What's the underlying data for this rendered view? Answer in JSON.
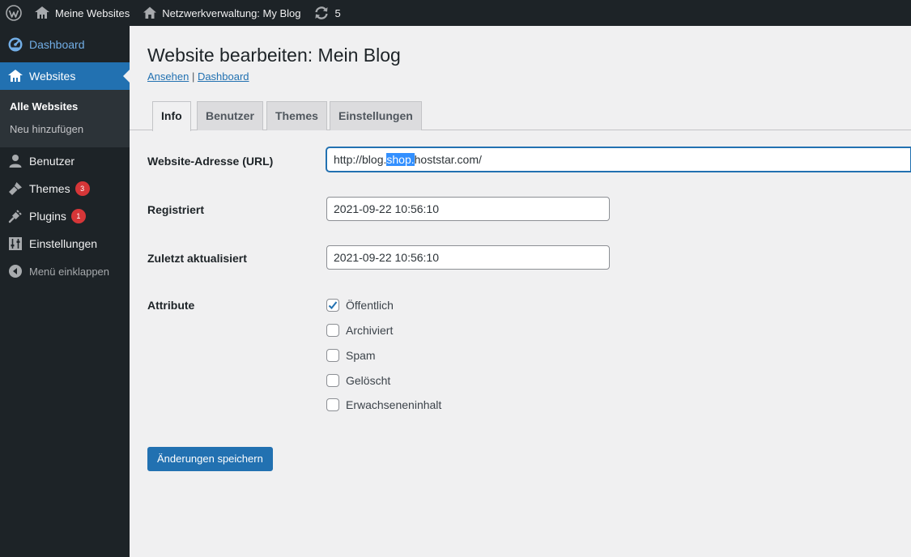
{
  "adminbar": {
    "my_sites": "Meine Websites",
    "network_admin": "Netzwerkverwaltung: My Blog",
    "updates_count": "5"
  },
  "sidebar": {
    "dashboard": "Dashboard",
    "websites": "Websites",
    "sub_all": "Alle Websites",
    "sub_new": "Neu hinzufügen",
    "users": "Benutzer",
    "themes": "Themes",
    "themes_badge": "3",
    "plugins": "Plugins",
    "plugins_badge": "1",
    "settings": "Einstellungen",
    "collapse": "Menü einklappen"
  },
  "main": {
    "title": "Website bearbeiten: Mein Blog",
    "link_view": "Ansehen",
    "link_sep": " | ",
    "link_dashboard": "Dashboard",
    "tabs": [
      "Info",
      "Benutzer",
      "Themes",
      "Einstellungen"
    ]
  },
  "form": {
    "url_label": "Website-Adresse (URL)",
    "url_before": "http://blog.",
    "url_selected": "shop.",
    "url_after": "hoststar.com/",
    "registered_label": "Registriert",
    "registered_value": "2021-09-22 10:56:10",
    "updated_label": "Zuletzt aktualisiert",
    "updated_value": "2021-09-22 10:56:10",
    "attributes_label": "Attribute",
    "attributes": [
      {
        "label": "Öffentlich",
        "checked": true
      },
      {
        "label": "Archiviert",
        "checked": false
      },
      {
        "label": "Spam",
        "checked": false
      },
      {
        "label": "Gelöscht",
        "checked": false
      },
      {
        "label": "Erwachseneninhalt",
        "checked": false
      }
    ],
    "save": "Änderungen speichern"
  },
  "colors": {
    "admin_dark": "#1d2327",
    "accent": "#2271b1",
    "badge": "#d63638",
    "selection": "#3390ff"
  },
  "icons": [
    "wordpress-icon",
    "my-sites-icon",
    "home-icon",
    "updates-icon",
    "dashboard-icon",
    "websites-icon",
    "users-icon",
    "themes-icon",
    "plugins-icon",
    "settings-icon",
    "collapse-icon",
    "checkmark-icon"
  ]
}
